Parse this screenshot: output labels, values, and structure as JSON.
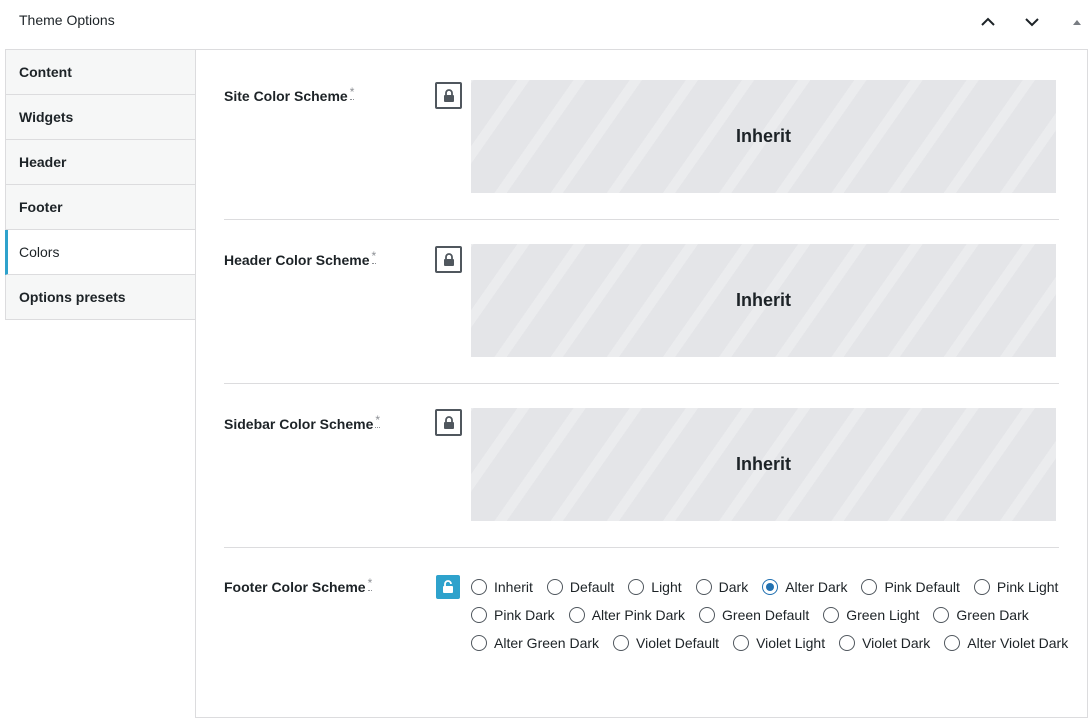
{
  "panel": {
    "title": "Theme Options"
  },
  "tabs": [
    {
      "label": "Content"
    },
    {
      "label": "Widgets"
    },
    {
      "label": "Header"
    },
    {
      "label": "Footer"
    },
    {
      "label": "Colors",
      "active": true
    },
    {
      "label": "Options presets"
    }
  ],
  "rows": {
    "site": {
      "label": "Site Color Scheme",
      "required": "*",
      "value": "Inherit",
      "locked": true
    },
    "header": {
      "label": "Header Color Scheme",
      "required": "*",
      "value": "Inherit",
      "locked": true
    },
    "sidebar": {
      "label": "Sidebar Color Scheme",
      "required": "*",
      "value": "Inherit",
      "locked": true
    },
    "footer": {
      "label": "Footer Color Scheme",
      "required": "*",
      "locked": false,
      "selected": "Alter Dark",
      "options": [
        "Inherit",
        "Default",
        "Light",
        "Dark",
        "Alter Dark",
        "Pink Default",
        "Pink Light",
        "Pink Dark",
        "Alter Pink Dark",
        "Green Default",
        "Green Light",
        "Green Dark",
        "Alter Green Dark",
        "Violet Default",
        "Violet Light",
        "Violet Dark",
        "Alter Violet Dark"
      ]
    }
  },
  "colors": {
    "accent": "#2ea2cc",
    "radio_checked": "#2271b1"
  },
  "icons": {
    "move_up": "chevron-up-icon",
    "move_down": "chevron-down-icon",
    "toggle": "triangle-up-icon",
    "lock": "lock-icon",
    "unlock": "unlock-icon"
  }
}
